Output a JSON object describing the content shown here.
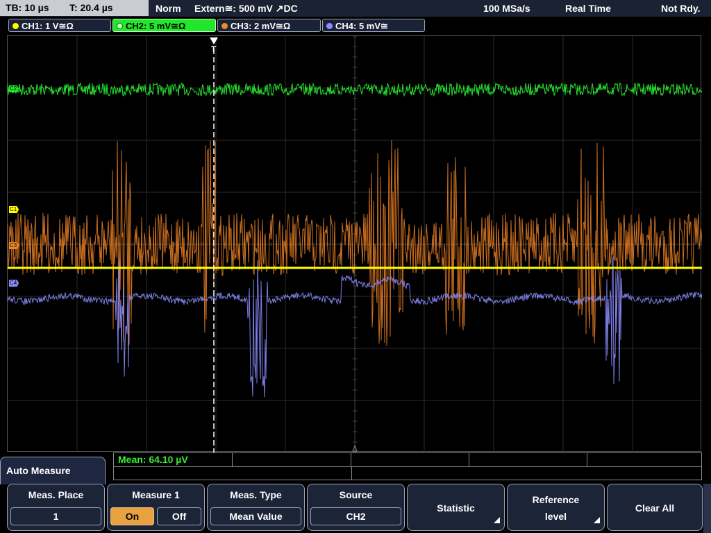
{
  "status_bar": {
    "timebase": "TB: 10 µs",
    "trigger_time": "T: 20.4 µs",
    "trigger_mode": "Norm",
    "trigger_source": "Extern≅: 500 mV ↗DC",
    "sample_rate": "100 MSa/s",
    "acquisition_mode": "Real Time",
    "state": "Not Rdy."
  },
  "channels": [
    {
      "label": "CH1: 1 V≅Ω",
      "color": "#ffff00",
      "active": false
    },
    {
      "label": "CH2: 5 mV≅Ω",
      "color": "#22e62a",
      "active": true
    },
    {
      "label": "CH3: 2 mV≅Ω",
      "color": "#f08a2a",
      "active": false
    },
    {
      "label": "CH4: 5 mV≅",
      "color": "#8c8cff",
      "active": false
    }
  ],
  "markers": {
    "c1": "C1",
    "c2": "C2",
    "c3": "C3",
    "c4": "C4",
    "trigger": "T"
  },
  "measurement": {
    "result": "Mean: 64.10 µV"
  },
  "menu": {
    "title": "Auto Measure",
    "meas_place": {
      "label": "Meas. Place",
      "value": "1"
    },
    "measure1": {
      "label": "Measure 1",
      "on": "On",
      "off": "Off",
      "state": "On"
    },
    "meas_type": {
      "label": "Meas. Type",
      "value": "Mean Value"
    },
    "source": {
      "label": "Source",
      "value": "CH2"
    },
    "statistic": {
      "label": "Statistic"
    },
    "reference_level": {
      "line1": "Reference",
      "line2": "level"
    },
    "clear_all": {
      "label": "Clear All"
    }
  }
}
